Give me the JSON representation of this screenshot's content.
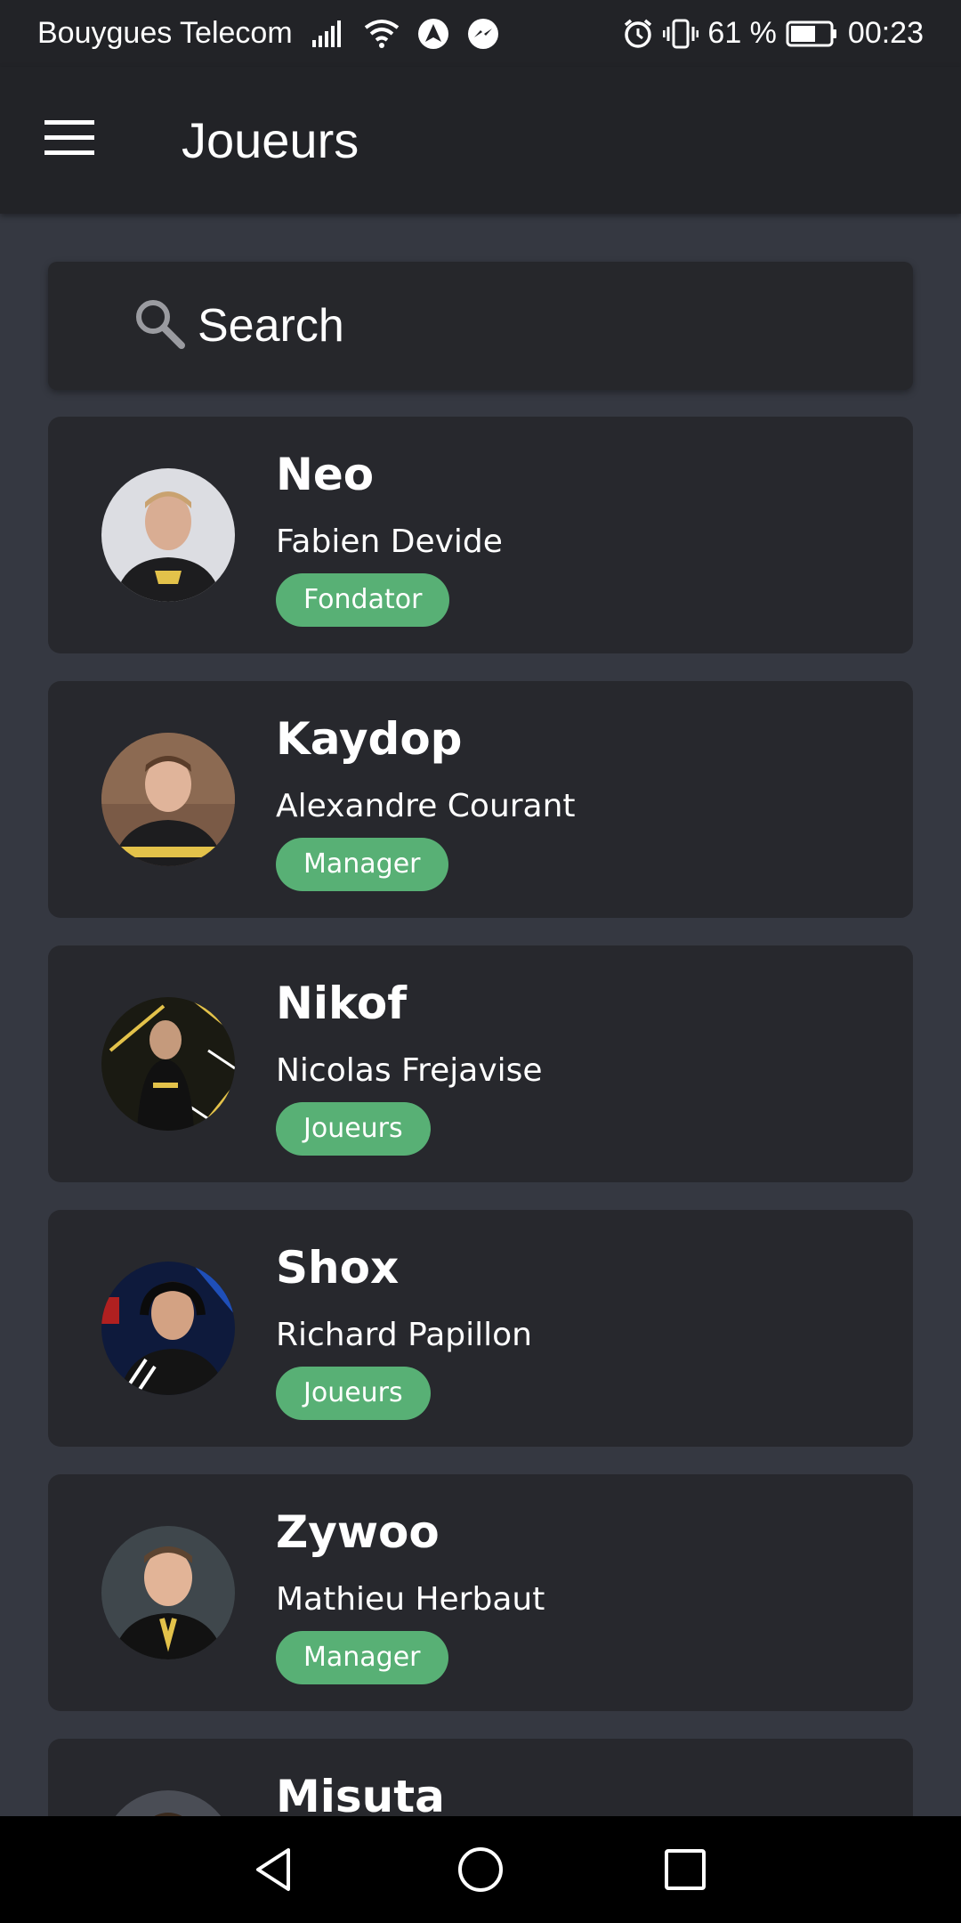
{
  "status_bar": {
    "carrier": "Bouygues Telecom",
    "battery_percent": "61 %",
    "time": "00:23",
    "icons": [
      "signal-icon",
      "wifi-icon",
      "navigation-app-icon",
      "messenger-icon",
      "alarm-icon",
      "vibrate-icon",
      "battery-icon"
    ],
    "battery_level": 0.61
  },
  "app_bar": {
    "title": "Joueurs",
    "menu_icon": "hamburger-menu-icon"
  },
  "search": {
    "placeholder": "Search",
    "value": ""
  },
  "colors": {
    "background": "#353841",
    "surface": "#27282d",
    "appbar": "#222327",
    "badge": "#58b075",
    "text": "#ffffff"
  },
  "players": [
    {
      "nickname": "Neo",
      "name": "Fabien Devide",
      "role": "Fondator"
    },
    {
      "nickname": "Kaydop",
      "name": "Alexandre Courant",
      "role": "Manager"
    },
    {
      "nickname": "Nikof",
      "name": "Nicolas Frejavise",
      "role": "Joueurs"
    },
    {
      "nickname": "Shox",
      "name": "Richard Papillon",
      "role": "Joueurs"
    },
    {
      "nickname": "Zywoo",
      "name": "Mathieu Herbaut",
      "role": "Manager"
    },
    {
      "nickname": "Misuta",
      "name": "",
      "role": ""
    }
  ],
  "nav_bar": {
    "icons": [
      "back-icon",
      "home-icon",
      "recents-icon"
    ]
  }
}
